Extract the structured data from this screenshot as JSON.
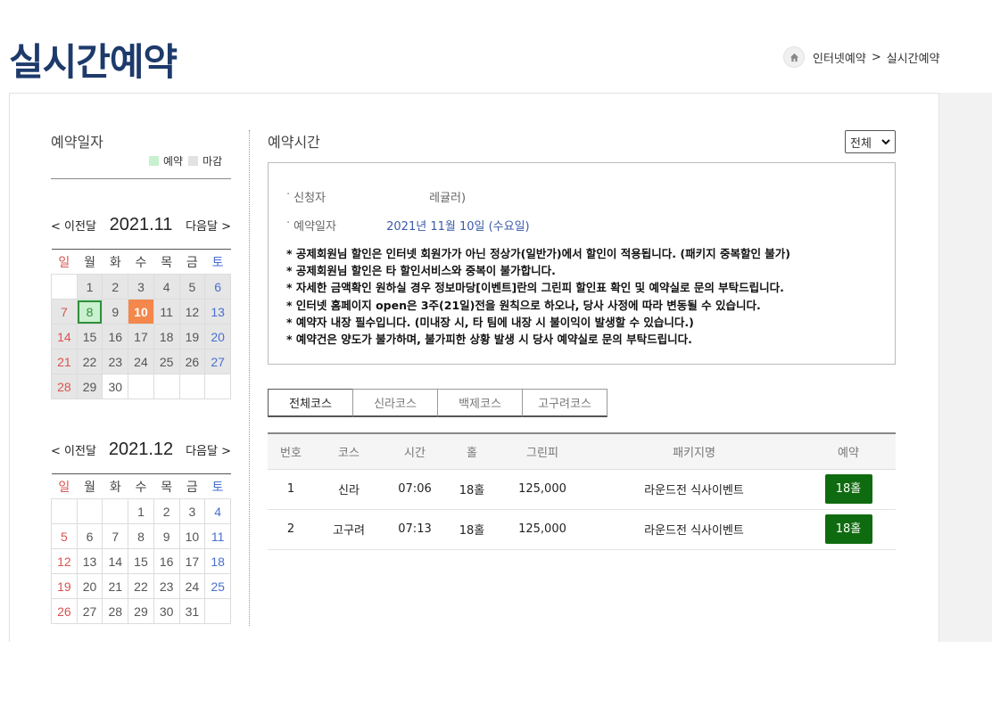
{
  "header": {
    "title": "실시간예약",
    "breadcrumb": [
      "인터넷예약",
      "실시간예약"
    ],
    "breadcrumb_sep": ">"
  },
  "sidebar": {
    "title": "예약일자",
    "legend": {
      "reserve": "예약",
      "closed": "마감"
    },
    "weekdays": [
      "일",
      "월",
      "화",
      "수",
      "목",
      "금",
      "토"
    ],
    "calendars": [
      {
        "prev": "< 이전달",
        "next": "다음달 >",
        "title": "2021.11",
        "weeks": [
          [
            {
              "d": "",
              "s": "open"
            },
            {
              "d": "1",
              "s": "closed"
            },
            {
              "d": "2",
              "s": "closed"
            },
            {
              "d": "3",
              "s": "closed"
            },
            {
              "d": "4",
              "s": "closed"
            },
            {
              "d": "5",
              "s": "closed"
            },
            {
              "d": "6",
              "s": "closed"
            }
          ],
          [
            {
              "d": "7",
              "s": "closed"
            },
            {
              "d": "8",
              "s": "res"
            },
            {
              "d": "9",
              "s": "closed"
            },
            {
              "d": "10",
              "s": "today"
            },
            {
              "d": "11",
              "s": "closed"
            },
            {
              "d": "12",
              "s": "closed"
            },
            {
              "d": "13",
              "s": "closed"
            }
          ],
          [
            {
              "d": "14",
              "s": "closed"
            },
            {
              "d": "15",
              "s": "closed"
            },
            {
              "d": "16",
              "s": "closed"
            },
            {
              "d": "17",
              "s": "closed"
            },
            {
              "d": "18",
              "s": "closed"
            },
            {
              "d": "19",
              "s": "closed"
            },
            {
              "d": "20",
              "s": "closed"
            }
          ],
          [
            {
              "d": "21",
              "s": "closed"
            },
            {
              "d": "22",
              "s": "closed"
            },
            {
              "d": "23",
              "s": "closed"
            },
            {
              "d": "24",
              "s": "closed"
            },
            {
              "d": "25",
              "s": "closed"
            },
            {
              "d": "26",
              "s": "closed"
            },
            {
              "d": "27",
              "s": "closed"
            }
          ],
          [
            {
              "d": "28",
              "s": "closed"
            },
            {
              "d": "29",
              "s": "closed"
            },
            {
              "d": "30",
              "s": "open"
            },
            {
              "d": "",
              "s": "open"
            },
            {
              "d": "",
              "s": "open"
            },
            {
              "d": "",
              "s": "open"
            },
            {
              "d": "",
              "s": "open"
            }
          ]
        ]
      },
      {
        "prev": "< 이전달",
        "next": "다음달 >",
        "title": "2021.12",
        "weeks": [
          [
            {
              "d": "",
              "s": "open"
            },
            {
              "d": "",
              "s": "open"
            },
            {
              "d": "",
              "s": "open"
            },
            {
              "d": "1",
              "s": "open"
            },
            {
              "d": "2",
              "s": "open"
            },
            {
              "d": "3",
              "s": "open"
            },
            {
              "d": "4",
              "s": "open"
            }
          ],
          [
            {
              "d": "5",
              "s": "open"
            },
            {
              "d": "6",
              "s": "open"
            },
            {
              "d": "7",
              "s": "open"
            },
            {
              "d": "8",
              "s": "open"
            },
            {
              "d": "9",
              "s": "open"
            },
            {
              "d": "10",
              "s": "open"
            },
            {
              "d": "11",
              "s": "open"
            }
          ],
          [
            {
              "d": "12",
              "s": "open"
            },
            {
              "d": "13",
              "s": "open"
            },
            {
              "d": "14",
              "s": "open"
            },
            {
              "d": "15",
              "s": "open"
            },
            {
              "d": "16",
              "s": "open"
            },
            {
              "d": "17",
              "s": "open"
            },
            {
              "d": "18",
              "s": "open"
            }
          ],
          [
            {
              "d": "19",
              "s": "open"
            },
            {
              "d": "20",
              "s": "open"
            },
            {
              "d": "21",
              "s": "open"
            },
            {
              "d": "22",
              "s": "open"
            },
            {
              "d": "23",
              "s": "open"
            },
            {
              "d": "24",
              "s": "open"
            },
            {
              "d": "25",
              "s": "open"
            }
          ],
          [
            {
              "d": "26",
              "s": "open"
            },
            {
              "d": "27",
              "s": "open"
            },
            {
              "d": "28",
              "s": "open"
            },
            {
              "d": "29",
              "s": "open"
            },
            {
              "d": "30",
              "s": "open"
            },
            {
              "d": "31",
              "s": "open"
            },
            {
              "d": "",
              "s": "open"
            }
          ]
        ]
      }
    ]
  },
  "main": {
    "title": "예약시간",
    "filter": {
      "selected": "전체"
    },
    "info": {
      "applicant_label": "신청자",
      "applicant_value": "레귤러)",
      "date_label": "예약일자",
      "date_value": "2021년 11월 10일 (수요일)"
    },
    "notes": [
      "* 공제회원님 할인은 인터넷 회원가가 아닌 정상가(일반가)에서 할인이 적용됩니다. (패키지 중복할인 불가)",
      "* 공제회원님 할인은 타 할인서비스와 중복이 불가합니다.",
      "* 자세한 금액확인 원하실 경우 정보마당[이벤트]란의 그린피 할인표 확인 및 예약실로 문의 부탁드립니다.",
      "* 인터넷 홈페이지 open은 3주(21일)전을 원칙으로 하오나, 당사 사정에 따라 변동될 수 있습니다.",
      "* 예약자 내장 필수입니다. (미내장 시, 타 팀에 내장 시 불이익이 발생할 수 있습니다.)",
      "* 예약건은 양도가 불가하며, 불가피한 상황 발생 시 당사 예약실로 문의 부탁드립니다."
    ],
    "tabs": [
      "전체코스",
      "신라코스",
      "백제코스",
      "고구려코스"
    ],
    "table": {
      "headers": [
        "번호",
        "코스",
        "시간",
        "홀",
        "그린피",
        "패키지명",
        "예약"
      ],
      "rows": [
        [
          "1",
          "신라",
          "07:06",
          "18홀",
          "125,000",
          "라운드전 식사이벤트",
          "18홀"
        ],
        [
          "2",
          "고구려",
          "07:13",
          "18홀",
          "125,000",
          "라운드전 식사이벤트",
          "18홀"
        ]
      ]
    }
  },
  "colors": {
    "title": "#1d3a6b",
    "today": "#f4874b",
    "reserve": "#c9f0cf",
    "closed": "#e6e6e6",
    "button": "#0f6b0f",
    "date_text": "#3b5aa8"
  },
  "icons": {
    "home": "home-icon",
    "dropdown": "chevron-down-icon"
  }
}
